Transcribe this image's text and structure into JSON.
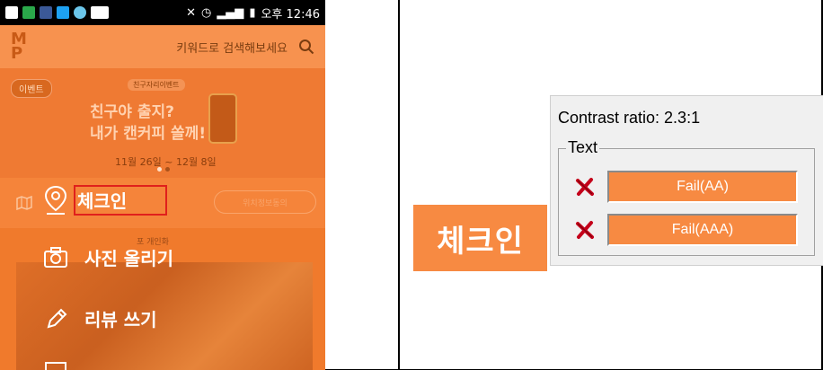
{
  "status_bar": {
    "time": "오후 12:46"
  },
  "phone": {
    "search_placeholder": "키워드로 검색해보세요",
    "banner": {
      "badge": "이벤트",
      "tag": "친구자리이벤트",
      "line1": "친구야 출지?",
      "line2": "내가 캔커피 쏠께!",
      "date": "11월 26일 ~ 12월 8일"
    },
    "checkin_label": "체크인",
    "feed_pill": "위치정보동의",
    "caption_small": "포 개인화",
    "menu": [
      {
        "label": "사진 올리기",
        "icon": "camera-icon"
      },
      {
        "label": "리뷰 쓰기",
        "icon": "pencil-icon"
      }
    ]
  },
  "crop": {
    "label": "체크인",
    "background": "#f78a42"
  },
  "contrast_panel": {
    "ratio_text": "Contrast ratio: 2.3:1",
    "group_title": "Text",
    "results": [
      {
        "label": "Fail(AA)",
        "status": "fail"
      },
      {
        "label": "Fail(AAA)",
        "status": "fail"
      }
    ]
  },
  "colors": {
    "accent_orange": "#f5843a",
    "fail_red": "#c4001a",
    "highlight_red": "#e0201c"
  }
}
